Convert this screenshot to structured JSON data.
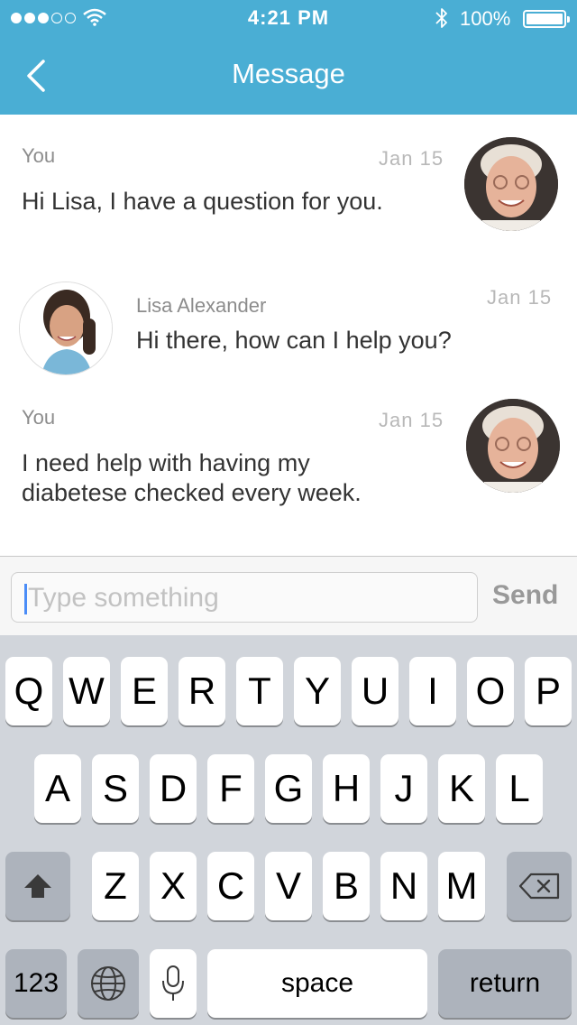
{
  "status_bar": {
    "time": "4:21 PM",
    "battery_percent": "100%",
    "signal_bars_filled": 3,
    "signal_bars_total": 5
  },
  "header": {
    "title": "Message"
  },
  "messages": [
    {
      "sender": "You",
      "date": "Jan 15",
      "text": "Hi Lisa, I have a question for you.",
      "avatar": "elderly-woman-avatar"
    },
    {
      "sender": "Lisa Alexander",
      "date": "Jan 15",
      "text": "Hi there, how can I help you?",
      "avatar": "nurse-avatar"
    },
    {
      "sender": "You",
      "date": "Jan 15",
      "text_line1": "I need help with having my",
      "text_line2": "diabetese checked every week.",
      "avatar": "elderly-woman-avatar"
    }
  ],
  "input": {
    "placeholder": "Type something",
    "value": "",
    "send_label": "Send"
  },
  "keyboard": {
    "row1": [
      "Q",
      "W",
      "E",
      "R",
      "T",
      "Y",
      "U",
      "I",
      "O",
      "P"
    ],
    "row2": [
      "A",
      "S",
      "D",
      "F",
      "G",
      "H",
      "J",
      "K",
      "L"
    ],
    "row3": [
      "Z",
      "X",
      "C",
      "V",
      "B",
      "N",
      "M"
    ],
    "numbers_label": "123",
    "space_label": "space",
    "return_label": "return"
  },
  "colors": {
    "header": "#4aaed4",
    "keyboard": "#d1d5db",
    "caret": "#4a8cf7"
  }
}
